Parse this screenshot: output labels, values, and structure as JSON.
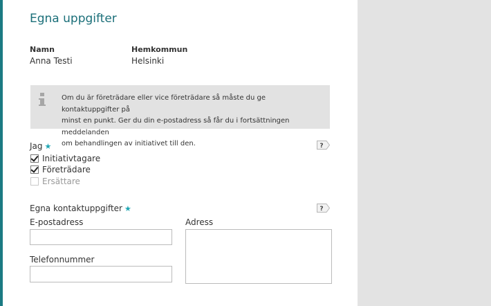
{
  "title": "Egna uppgifter",
  "name_field": {
    "label": "Namn",
    "value": "Anna Testi"
  },
  "municipality_field": {
    "label": "Hemkommun",
    "value": "Helsinki"
  },
  "info": {
    "line1": "Om du är företrädare eller vice företrädare så måste du ge kontaktuppgifter på",
    "line2": "minst en punkt. Ger du din e-postadress så får du i fortsättningen meddelanden",
    "line3": "om behandlingen av initiativet till den."
  },
  "role": {
    "label": "Jag",
    "required_mark": "★",
    "help": "?",
    "options": [
      {
        "label": "Initiativtagare",
        "checked": true
      },
      {
        "label": "Företrädare",
        "checked": true
      },
      {
        "label": "Ersättare",
        "checked": false,
        "disabled": true
      }
    ]
  },
  "contact": {
    "label": "Egna kontaktuppgifter",
    "required_mark": "★",
    "help": "?",
    "email_label": "E-postadress",
    "email_value": "",
    "address_label": "Adress",
    "address_value": "",
    "phone_label": "Telefonnummer",
    "phone_value": ""
  },
  "colors": {
    "accent": "#1b7a83",
    "title": "#1b6f79",
    "star": "#1fa6b3",
    "info_bg": "#e2e2e2",
    "side_bg": "#e3e3e3"
  }
}
